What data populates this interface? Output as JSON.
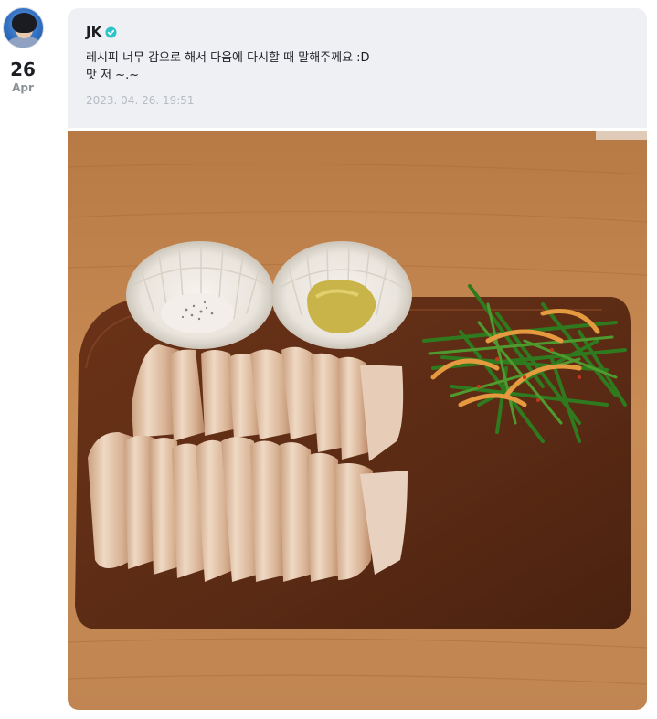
{
  "post": {
    "date_day": "26",
    "date_month": "Apr",
    "author": "JK",
    "message_line1": "레시피 너무 감으로 해서 다음에 다시할 때 말해주께요 :D",
    "message_line2": "맛 저 ~.~",
    "timestamp": "2023. 04. 26. 19:51"
  },
  "icons": {
    "verified": "verified-badge-icon",
    "avatar": "profile-avatar"
  },
  "colors": {
    "card_bg": "#eef0f4",
    "verified": "#2fc3c9",
    "timestamp": "#b7bbc3"
  }
}
